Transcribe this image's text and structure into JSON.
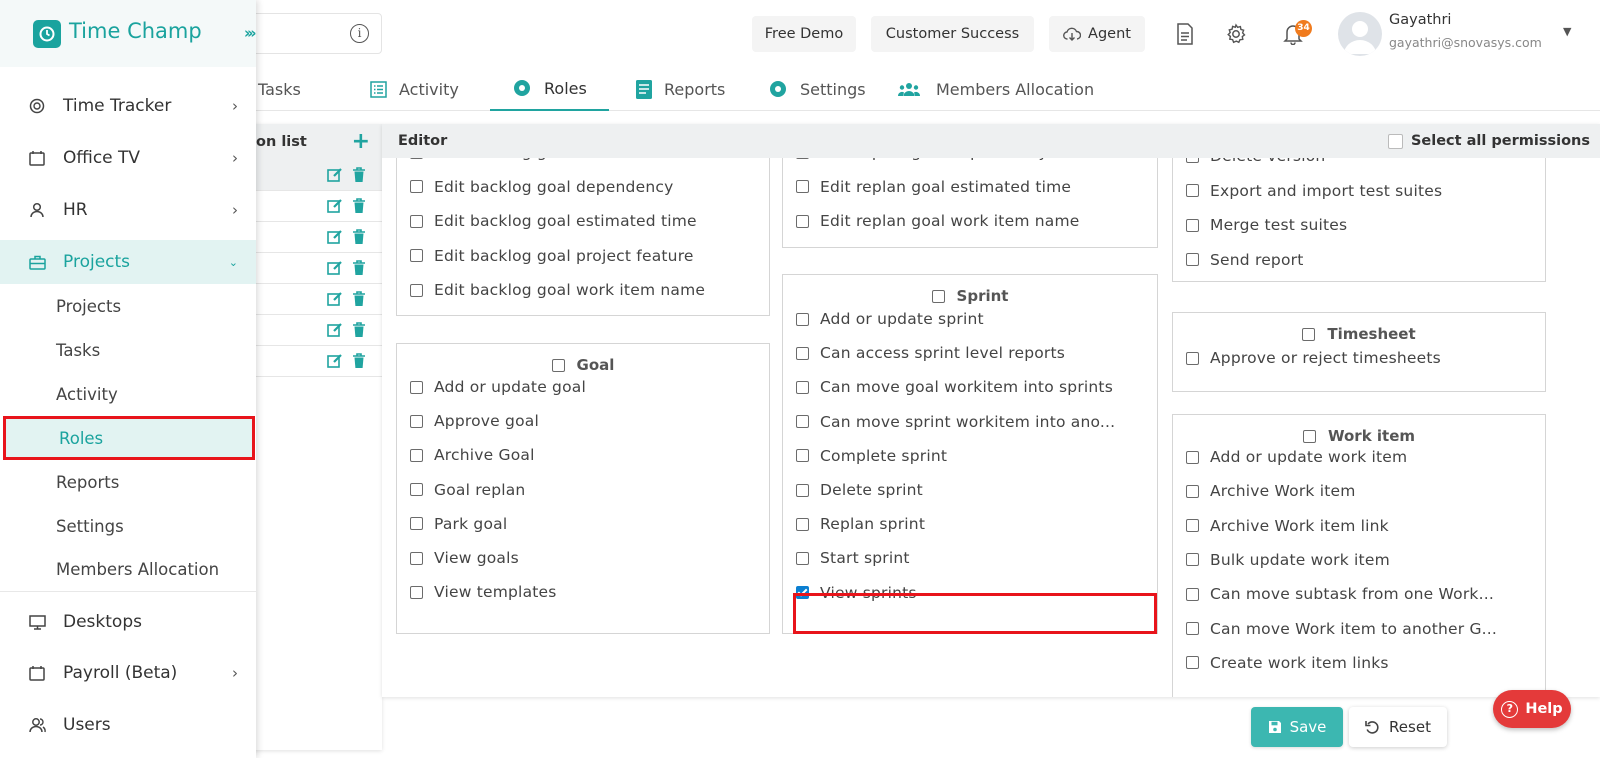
{
  "app": {
    "name": "Time Champ"
  },
  "topbar": {
    "free_demo": "Free Demo",
    "customer_success": "Customer Success",
    "agent": "Agent",
    "notification_count": "34",
    "user_name": "Gayathri",
    "user_email": "gayathri@snovasys.com"
  },
  "sidebar": {
    "items": [
      {
        "label": "Time Tracker",
        "icon": "stopwatch-icon"
      },
      {
        "label": "Office TV",
        "icon": "tv-icon"
      },
      {
        "label": "HR",
        "icon": "person-icon"
      },
      {
        "label": "Projects",
        "icon": "briefcase-icon"
      },
      {
        "label": "Desktops",
        "icon": "monitor-icon"
      },
      {
        "label": "Payroll (Beta)",
        "icon": "calendar-icon"
      },
      {
        "label": "Users",
        "icon": "users-icon"
      }
    ],
    "sub_items": [
      "Projects",
      "Tasks",
      "Activity",
      "Roles",
      "Reports",
      "Settings",
      "Members Allocation"
    ]
  },
  "tabs": [
    "Tasks",
    "Activity",
    "Roles",
    "Reports",
    "Settings",
    "Members Allocation"
  ],
  "rolelist": {
    "title": "on list"
  },
  "editor": {
    "title": "Editor",
    "select_all": "Select all permissions",
    "col1_top": [
      "Edit backlog goal deadline date",
      "Edit backlog goal dependency",
      "Edit backlog goal estimated time",
      "Edit backlog goal project feature",
      "Edit backlog goal work item name"
    ],
    "goal": {
      "title": "Goal",
      "items": [
        "Add or update goal",
        "Approve goal",
        "Archive Goal",
        "Goal replan",
        "Park goal",
        "View goals",
        "View templates"
      ]
    },
    "col2_top": [
      "Edit replan goal dependency",
      "Edit replan goal estimated time",
      "Edit replan goal work item name"
    ],
    "sprint": {
      "title": "Sprint",
      "items": [
        "Add or update sprint",
        "Can access sprint level reports",
        "Can move goal workitem into sprints",
        "Can move sprint workitem into ano...",
        "Complete sprint",
        "Delete sprint",
        "Replan sprint",
        "Start sprint",
        "View sprints"
      ]
    },
    "col3_top": [
      "Delete version",
      "Export and import test suites",
      "Merge test suites",
      "Send report"
    ],
    "timesheet": {
      "title": "Timesheet",
      "items": [
        "Approve or reject timesheets"
      ]
    },
    "workitem": {
      "title": "Work item",
      "items": [
        "Add or update work item",
        "Archive Work item",
        "Archive Work item link",
        "Bulk update work item",
        "Can move subtask from one Work...",
        "Can move Work item to another G...",
        "Create work item links"
      ]
    }
  },
  "buttons": {
    "save": "Save",
    "reset": "Reset",
    "help": "Help"
  },
  "colors": {
    "brand": "#1aa39e",
    "highlight": "#e8141b",
    "checked": "#0b7fd1"
  }
}
